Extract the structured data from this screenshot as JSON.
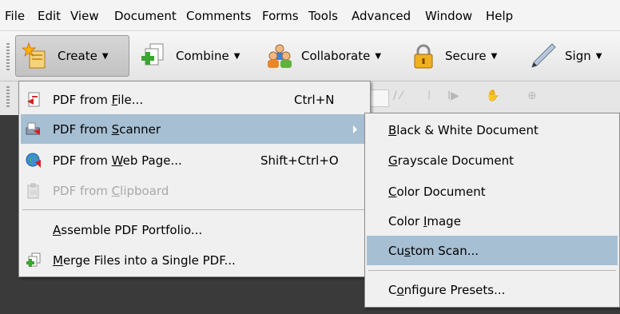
{
  "menubar": {
    "items": [
      "File",
      "Edit",
      "View",
      "Document",
      "Comments",
      "Forms",
      "Tools",
      "Advanced",
      "Window",
      "Help"
    ]
  },
  "toolbar": {
    "create": {
      "label": "Create",
      "icon": "create-sparkle-icon"
    },
    "combine": {
      "label": "Combine",
      "icon": "combine-files-icon"
    },
    "collaborate": {
      "label": "Collaborate",
      "icon": "people-icon"
    },
    "secure": {
      "label": "Secure",
      "icon": "padlock-icon"
    },
    "sign": {
      "label": "Sign",
      "icon": "pen-icon"
    }
  },
  "create_menu": {
    "items": [
      {
        "pre": "PDF from ",
        "acc": "F",
        "post": "ile...",
        "shortcut": "Ctrl+N",
        "icon": "pdf-file-icon",
        "state": "normal"
      },
      {
        "pre": "PDF from ",
        "acc": "S",
        "post": "canner",
        "shortcut": "",
        "icon": "scanner-icon",
        "state": "highlighted",
        "submenu": true
      },
      {
        "pre": "PDF from ",
        "acc": "W",
        "post": "eb Page...",
        "shortcut": "Shift+Ctrl+O",
        "icon": "web-globe-icon",
        "state": "normal"
      },
      {
        "pre": "PDF from ",
        "acc": "C",
        "post": "lipboard",
        "shortcut": "",
        "icon": "clipboard-icon",
        "state": "disabled"
      },
      {
        "pre": "",
        "acc": "A",
        "post": "ssemble PDF Portfolio...",
        "shortcut": "",
        "icon": "",
        "state": "normal"
      },
      {
        "pre": "",
        "acc": "M",
        "post": "erge Files into a Single PDF...",
        "shortcut": "",
        "icon": "merge-icon",
        "state": "normal"
      }
    ]
  },
  "scanner_submenu": {
    "items": [
      {
        "pre": "",
        "acc": "B",
        "post": "lack & White Document",
        "state": "normal"
      },
      {
        "pre": "",
        "acc": "G",
        "post": "rayscale Document",
        "state": "normal"
      },
      {
        "pre": "",
        "acc": "C",
        "post": "olor Document",
        "state": "normal"
      },
      {
        "pre": "Color ",
        "acc": "I",
        "post": "mage",
        "state": "normal"
      },
      {
        "pre": "Cu",
        "acc": "s",
        "post": "tom Scan...",
        "state": "highlighted"
      },
      {
        "pre": "C",
        "acc": "o",
        "post": "nfigure Presets...",
        "state": "normal"
      }
    ]
  }
}
